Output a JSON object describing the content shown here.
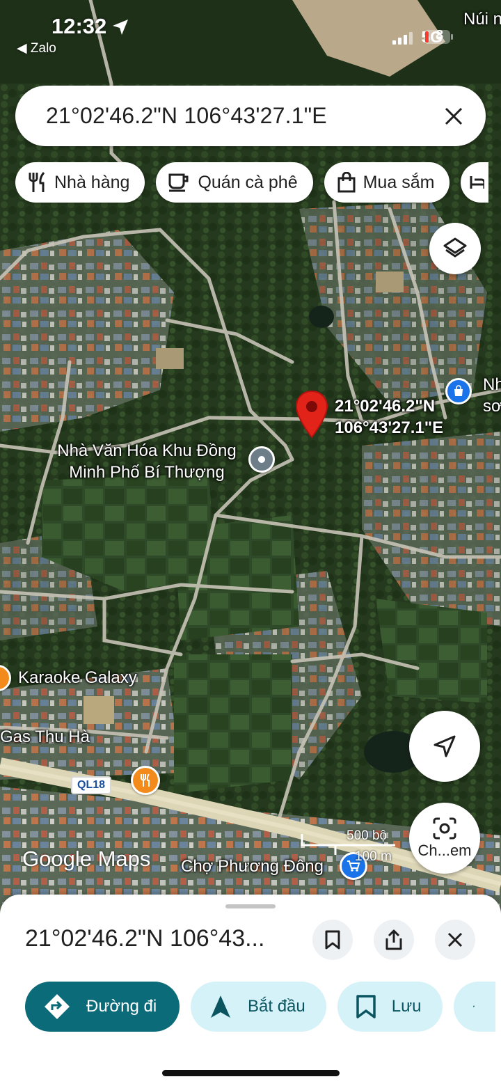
{
  "status_bar": {
    "time": "12:32",
    "back_app": "◀ Zalo",
    "network": "5G",
    "battery_level": "8"
  },
  "search": {
    "query": "21°02'46.2\"N 106°43'27.1\"E"
  },
  "chips": [
    {
      "label": "Nhà hàng",
      "icon": "restaurant-icon"
    },
    {
      "label": "Quán cà phê",
      "icon": "coffee-icon"
    },
    {
      "label": "Mua sắm",
      "icon": "shopping-bag-icon"
    }
  ],
  "map": {
    "dropped_pin_label_line1": "21°02'46.2\"N",
    "dropped_pin_label_line2": "106°43'27.1\"E",
    "place_line1": "Nhà Văn Hóa Khu Đồng",
    "place_line2": "Minh Phố Bí Thượng",
    "karaoke": "Karaoke Galaxy",
    "gas": "Gas Thu Hà",
    "market": "Chợ Phương Đông",
    "road": "QL18",
    "top_right_label": "Núi n",
    "right_label_line1": "Nh",
    "right_label_line2": "sơ",
    "logo": "Google Maps",
    "scale_top": "500 bộ",
    "scale_bottom": "100 m",
    "lens_label": "Ch...em"
  },
  "sheet": {
    "title": "21°02'46.2\"N 106°43...",
    "actions": [
      {
        "label": "Đường đi",
        "icon": "directions-icon"
      },
      {
        "label": "Bắt đầu",
        "icon": "navigation-arrow-icon"
      },
      {
        "label": "Lưu",
        "icon": "bookmark-icon"
      }
    ]
  },
  "colors": {
    "primary": "#0b6b78",
    "secondary_bg": "#d5f2f8",
    "pin_red": "#e2231a",
    "poi_blue": "#1a73e8",
    "poi_orange": "#f28b1c"
  }
}
